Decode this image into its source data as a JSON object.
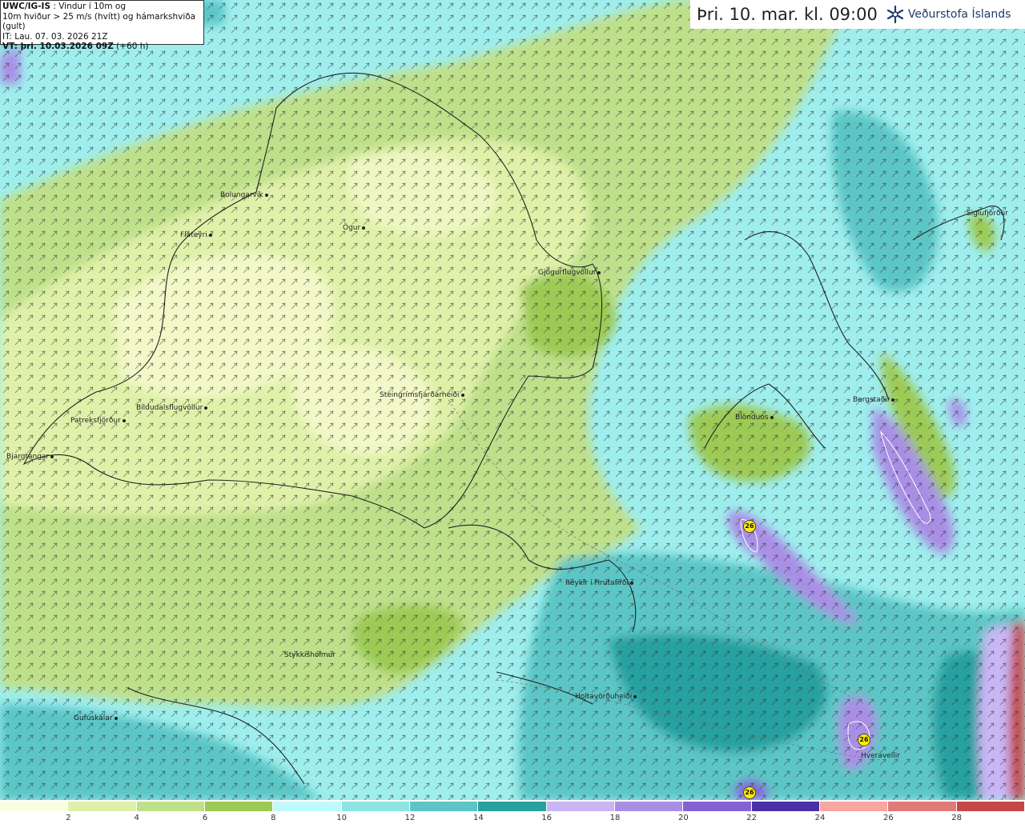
{
  "info": {
    "model": "UWC/IG-IS",
    "line1": " : Vindur í 10m og",
    "line2": "10m hviður > 25 m/s (hvítt) og hámarkshviða (gult)",
    "line3": "IT: Lau. 07. 03. 2026 21Z",
    "vt_label": "VT: þri. 10.03.2026 09Z",
    "vt_offset": " (+60 h)"
  },
  "header": {
    "timestamp": "Þri. 10. mar. kl. 09:00",
    "logo_text": "Veðurstofa Íslands",
    "logo_icon": "snowflake-logo-icon"
  },
  "places": [
    {
      "name": "Bolungarvík"
    },
    {
      "name": "Flateyri"
    },
    {
      "name": "Ögur"
    },
    {
      "name": "Gjögurflugvöllur"
    },
    {
      "name": "Steingrímsfjarðarheiði"
    },
    {
      "name": "Bíldudalsflugvöllur"
    },
    {
      "name": "Patreksfjörður"
    },
    {
      "name": "Bjargtangar"
    },
    {
      "name": "Siglufjörður"
    },
    {
      "name": "Bergstaðir"
    },
    {
      "name": "Blönduós"
    },
    {
      "name": "Reykir í Hrútafirði"
    },
    {
      "name": "Stykkishólmur"
    },
    {
      "name": "Holtavörðuheiði"
    },
    {
      "name": "Gufuskálar"
    },
    {
      "name": "Hveravellir"
    }
  ],
  "gust_markers": [
    {
      "value": "26"
    },
    {
      "value": "26"
    },
    {
      "value": "26"
    }
  ],
  "legend": {
    "colors": [
      "#fbfde0",
      "#dff1a8",
      "#bfe08a",
      "#9cca55",
      "#bff9f9",
      "#8ee3e3",
      "#5cc6c6",
      "#27a0a0",
      "#c9b6f5",
      "#a98ee6",
      "#8462d6",
      "#4a2fa7",
      "#f7a6a0",
      "#e07a77",
      "#c44848"
    ],
    "ticks": [
      "2",
      "4",
      "6",
      "8",
      "10",
      "12",
      "14",
      "16",
      "18",
      "20",
      "22",
      "24",
      "26",
      "28"
    ]
  }
}
